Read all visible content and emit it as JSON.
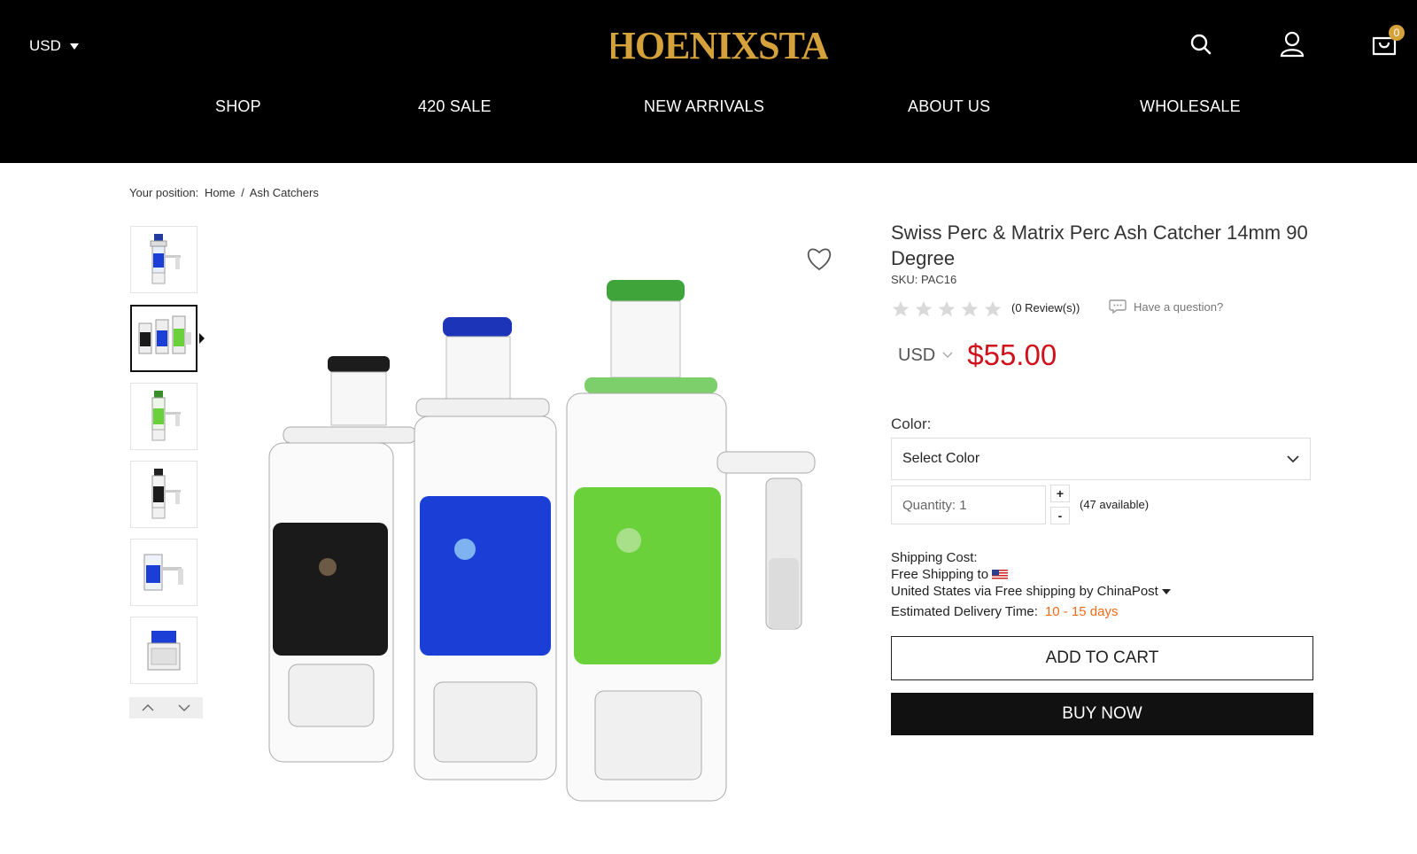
{
  "header": {
    "currency": "USD",
    "logo_text": "PHOENIXSTAR",
    "cart_count": "0",
    "nav": [
      "SHOP",
      "420 SALE",
      "NEW ARRIVALS",
      "ABOUT US",
      "WHOLESALE"
    ]
  },
  "breadcrumb": {
    "prefix": "Your position:",
    "home": "Home",
    "separator": "/",
    "current": "Ash Catchers"
  },
  "product": {
    "title": "Swiss Perc & Matrix Perc Ash Catcher 14mm 90 Degree",
    "sku": "SKU: PAC16",
    "rating": 0,
    "reviews": "(0 Review(s))",
    "question": "Have a question?",
    "currency": "USD",
    "price": "$55.00",
    "color_label": "Color:",
    "color_placeholder": "Select Color",
    "quantity_label": "Quantity: 1",
    "qty_plus": "+",
    "qty_minus": "-",
    "available": "(47 available)",
    "shipping_label": "Shipping Cost:",
    "shipping_free": "Free Shipping to",
    "shipping_via": "United States via Free shipping by ChinaPost",
    "eta_label": "Estimated Delivery Time:",
    "eta_value": "10 - 15 days",
    "add_to_cart": "ADD TO CART",
    "buy_now": "BUY NOW"
  },
  "colors": {
    "header_bg": "#000000",
    "logo_gold": "#d4a13a",
    "price_red": "#d0101a",
    "eta_orange": "#f26a1b",
    "glass_black": "#1a1a1a",
    "glass_blue": "#1b3fd6",
    "glass_green": "#6ad13a"
  }
}
